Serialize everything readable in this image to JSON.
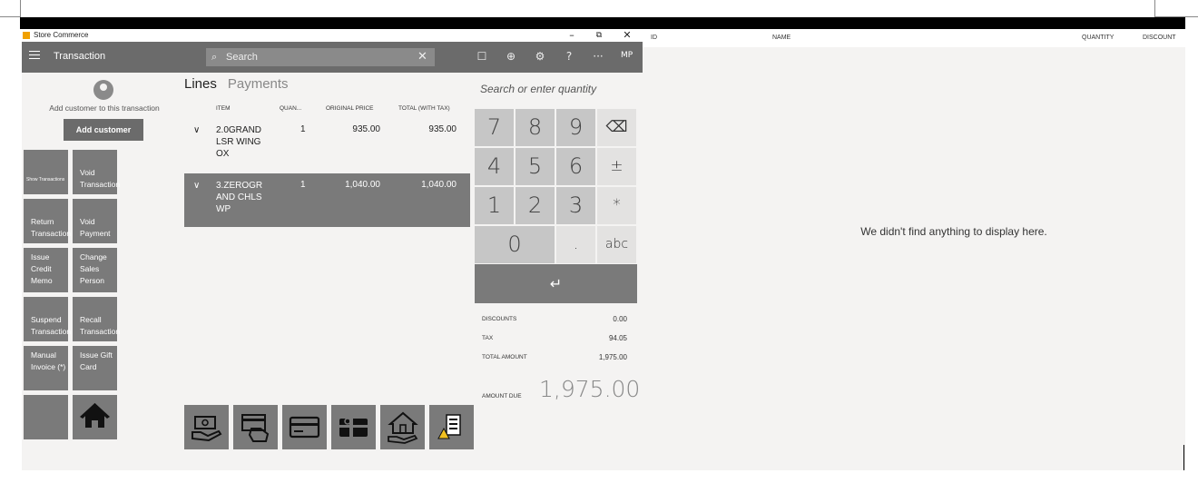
{
  "titlebar": {
    "app_title": "Store Commerce",
    "minimize": "–",
    "restore": "⧉",
    "close": "✕"
  },
  "header": {
    "title": "Transaction",
    "search_placeholder": "Search",
    "search_clear": "✕",
    "icons": [
      "message-icon",
      "globe-icon",
      "settings-icon",
      "help-icon",
      "more-icon"
    ],
    "icon_glyphs": [
      "☐",
      "⊕",
      "⚙",
      "?",
      "···"
    ],
    "user_initials": "MP"
  },
  "customer": {
    "prompt": "Add customer to this transaction",
    "add_button": "Add customer"
  },
  "operations": [
    {
      "label": "Show Transactions",
      "name": "show-transactions-tile"
    },
    {
      "label": "Void Transaction",
      "name": "void-transaction-tile"
    },
    {
      "label": "Return Transaction",
      "name": "return-transaction-tile"
    },
    {
      "label": "Void Payment",
      "name": "void-payment-tile"
    },
    {
      "label": "Issue Credit Memo",
      "name": "issue-credit-memo-tile"
    },
    {
      "label": "Change Sales Person",
      "name": "change-sales-person-tile"
    },
    {
      "label": "Suspend Transaction",
      "name": "suspend-transaction-tile"
    },
    {
      "label": "Recall Transaction",
      "name": "recall-transaction-tile"
    },
    {
      "label": "Manual Invoice (*)",
      "name": "manual-invoice-tile"
    },
    {
      "label": "Issue Gift Card",
      "name": "issue-gift-card-tile"
    }
  ],
  "tabs": {
    "lines": "Lines",
    "payments": "Payments"
  },
  "lines_table": {
    "headers": [
      "ITEM",
      "QUAN...",
      "ORIGINAL PRICE",
      "TOTAL (WITH TAX)"
    ],
    "rows": [
      {
        "item": "2.0GRAND LSR WING OX",
        "quantity": "1",
        "original_price": "935.00",
        "total": "935.00",
        "selected": false
      },
      {
        "item": "3.ZEROGR AND CHLS WP",
        "quantity": "1",
        "original_price": "1,040.00",
        "total": "1,040.00",
        "selected": true
      }
    ]
  },
  "payment_methods": [
    "pay-cash-icon",
    "pay-card-swipe-icon",
    "pay-card-icon",
    "pay-gift-card-icon",
    "pay-customer-account-icon",
    "pay-loyalty-icon"
  ],
  "numpad": {
    "placeholder": "Search or enter quantity",
    "keys": [
      "7",
      "8",
      "9",
      "⌫",
      "4",
      "5",
      "6",
      "±",
      "1",
      "2",
      "3",
      "*",
      "0",
      ".",
      "abc"
    ],
    "enter": "↵"
  },
  "totals": {
    "discounts_label": "DISCOUNTS",
    "discounts": "0.00",
    "tax_label": "TAX",
    "tax": "94.05",
    "total_label": "TOTAL AMOUNT",
    "total": "1,975.00",
    "due_label": "AMOUNT DUE",
    "due": "1,975.00"
  },
  "right_pane": {
    "columns": [
      "ID",
      "NAME",
      "QUANTITY",
      "DISCOUNT"
    ],
    "empty_message": "We didn't find anything to display here."
  }
}
